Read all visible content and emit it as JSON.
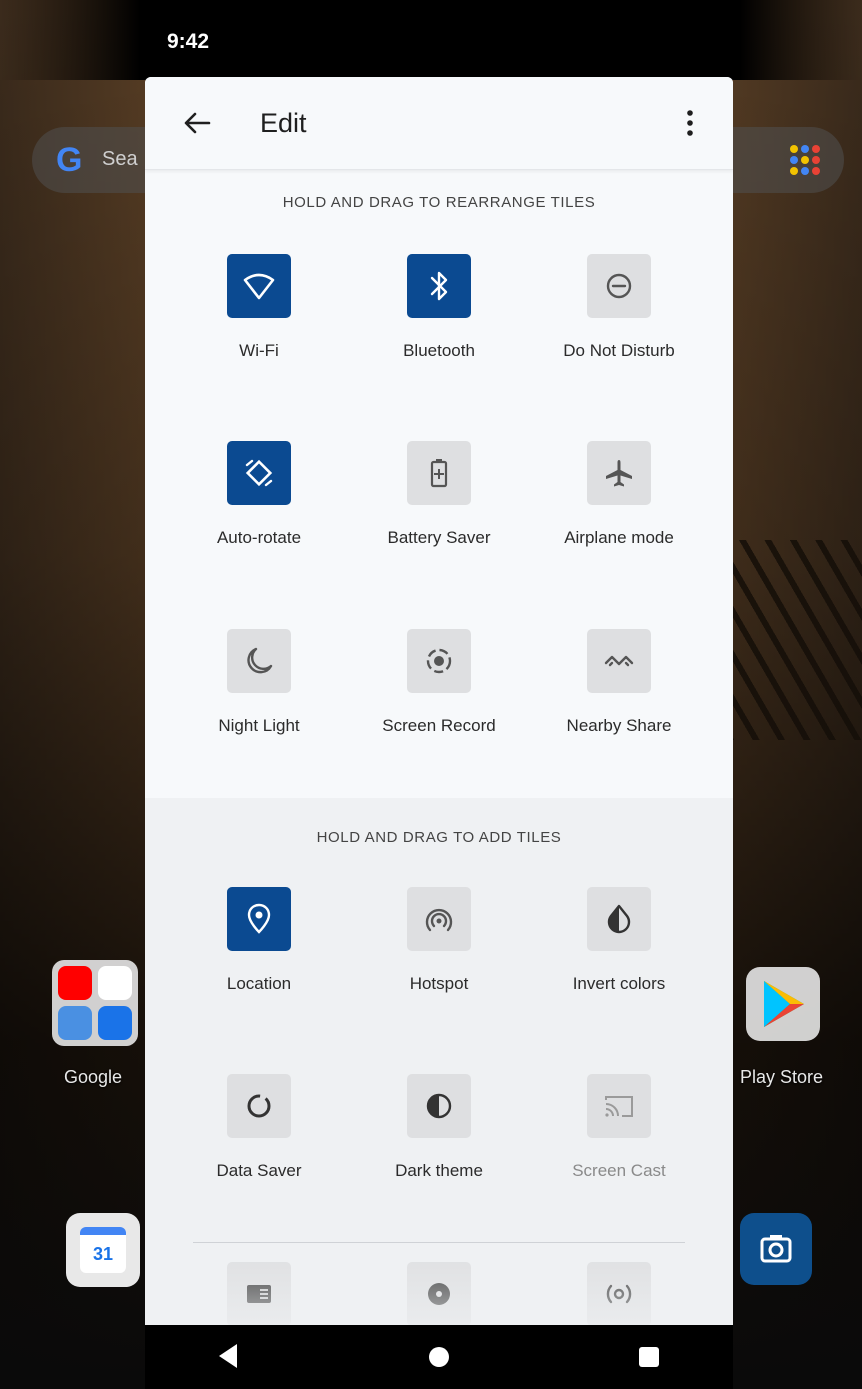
{
  "status_bar": {
    "time": "9:42"
  },
  "home": {
    "search_placeholder": "Sea",
    "google_folder_label": "Google",
    "play_store_label": "Play Store",
    "calendar_day": "31"
  },
  "header": {
    "title": "Edit"
  },
  "sections": {
    "rearrange_title": "HOLD AND DRAG TO REARRANGE TILES",
    "add_title": "HOLD AND DRAG TO ADD TILES"
  },
  "active_tiles": [
    {
      "label": "Wi-Fi",
      "icon": "wifi-icon",
      "on": true
    },
    {
      "label": "Bluetooth",
      "icon": "bluetooth-icon",
      "on": true
    },
    {
      "label": "Do Not Disturb",
      "icon": "do-not-disturb-icon",
      "on": false
    },
    {
      "label": "Auto-rotate",
      "icon": "auto-rotate-icon",
      "on": true
    },
    {
      "label": "Battery Saver",
      "icon": "battery-saver-icon",
      "on": false
    },
    {
      "label": "Airplane mode",
      "icon": "airplane-icon",
      "on": false
    },
    {
      "label": "Night Light",
      "icon": "night-light-icon",
      "on": false
    },
    {
      "label": "Screen Record",
      "icon": "screen-record-icon",
      "on": false
    },
    {
      "label": "Nearby Share",
      "icon": "nearby-share-icon",
      "on": false
    }
  ],
  "available_tiles": [
    {
      "label": "Location",
      "icon": "location-icon",
      "on": true
    },
    {
      "label": "Hotspot",
      "icon": "hotspot-icon",
      "on": false
    },
    {
      "label": "Invert colors",
      "icon": "invert-colors-icon",
      "on": false
    },
    {
      "label": "Data Saver",
      "icon": "data-saver-icon",
      "on": false
    },
    {
      "label": "Dark theme",
      "icon": "dark-theme-icon",
      "on": false
    },
    {
      "label": "Screen Cast",
      "icon": "screen-cast-icon",
      "on": false,
      "disabled": true
    }
  ],
  "partial_tiles": [
    {
      "icon": "reader-mode-icon"
    },
    {
      "icon": "record-dot-icon"
    },
    {
      "icon": "live-caption-icon"
    }
  ],
  "colors": {
    "tile_on": "#0b4a91",
    "tile_off": "#dedfe1",
    "panel_bg": "#f7f9fb",
    "add_section_bg": "#eff1f3"
  }
}
